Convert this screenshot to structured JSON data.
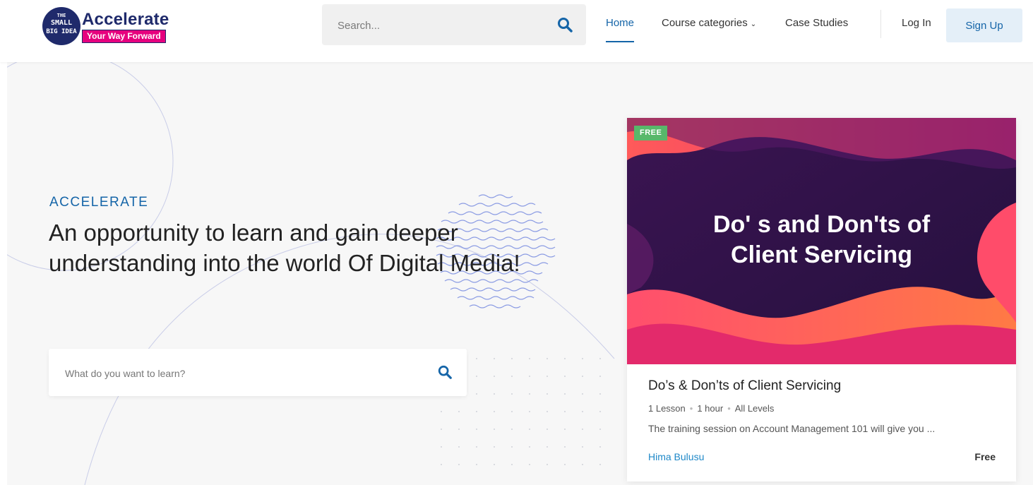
{
  "header": {
    "logo": {
      "badge_line1": "THE",
      "badge_line2": "SMALL",
      "badge_line3": "BIG IDEA",
      "title": "Accelerate",
      "tagline": "Your Way Forward"
    },
    "search": {
      "placeholder": "Search..."
    },
    "nav": {
      "home": "Home",
      "course_categories": "Course categories",
      "case_studies": "Case Studies",
      "login": "Log In",
      "signup": "Sign Up"
    }
  },
  "hero": {
    "eyebrow": "ACCELERATE",
    "headline": "An opportunity to learn and gain deeper understanding into the world Of Digital Media!",
    "learn_search": {
      "placeholder": "What do you want to learn?"
    }
  },
  "course_card": {
    "badge": "FREE",
    "thumbnail_title_line1": "Do' s and Don'ts of",
    "thumbnail_title_line2": "Client Servicing",
    "title": "Do’s & Don’ts of Client Servicing",
    "lessons": "1 Lesson",
    "duration": "1 hour",
    "level": "All Levels",
    "description": "The training session on Account Management 101 will give you ...",
    "author": "Hima Bulusu",
    "price": "Free"
  },
  "colors": {
    "primary": "#1565a8",
    "brand_navy": "#1f2a6b",
    "brand_pink": "#e6007e",
    "badge_green": "#58b86a",
    "link_blue": "#1e88c8"
  },
  "icons": {
    "search": "search-icon",
    "chevron": "chevron-down-icon"
  }
}
